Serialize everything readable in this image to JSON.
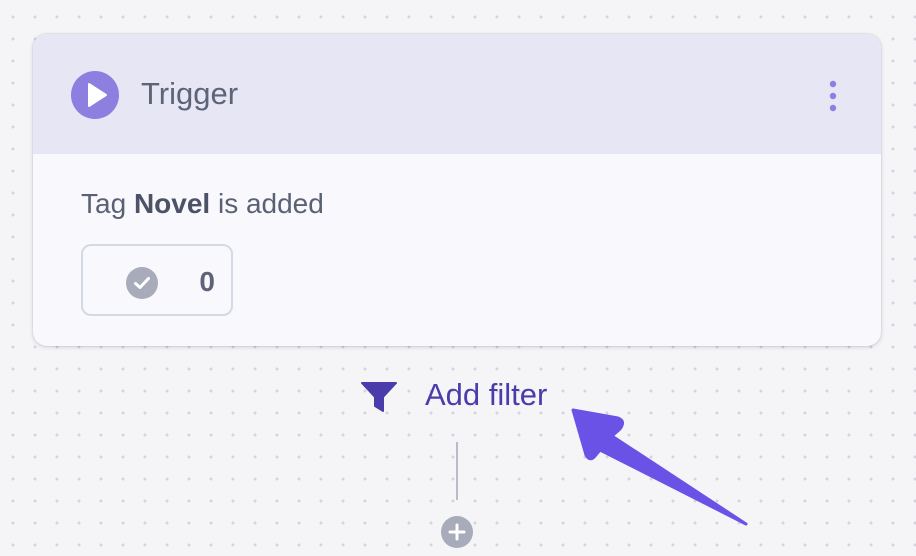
{
  "trigger_card": {
    "title": "Trigger",
    "title_icon": "play-icon",
    "menu_icon": "more-vertical-icon",
    "description": {
      "prefix": "Tag",
      "tag_name": "Novel",
      "suffix": "is added"
    },
    "count_badge": {
      "icon": "check-circle-icon",
      "value": "0"
    }
  },
  "add_filter": {
    "icon": "funnel-icon",
    "label": "Add filter"
  },
  "add_step": {
    "icon": "plus-circle-icon"
  },
  "annotation": {
    "icon": "pointer-arrow-icon"
  },
  "colors": {
    "accent": "#5a4bd1",
    "link": "#4a3dab",
    "header_bg": "#e6e6f4",
    "play_icon": "#8c7fe0",
    "arrow": "#6a52e6",
    "muted_icon": "#a7abba"
  }
}
